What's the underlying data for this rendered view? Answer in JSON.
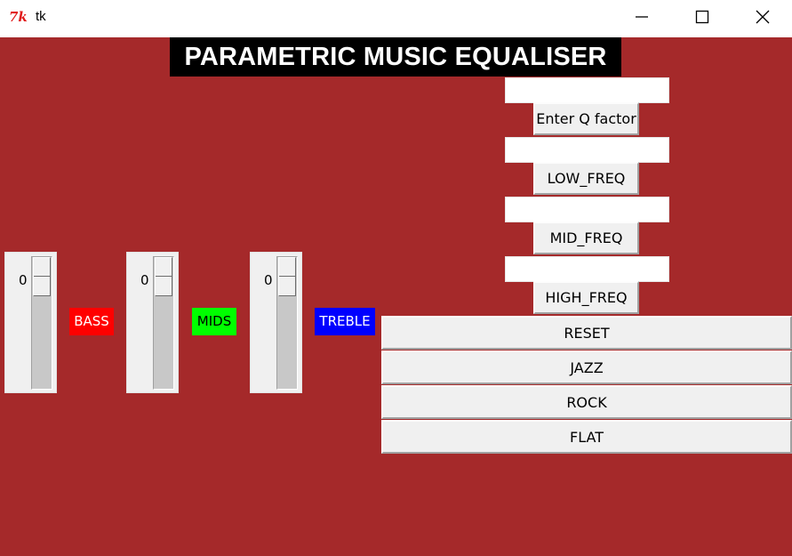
{
  "window": {
    "title": "tk",
    "icon_name": "tk-feather-icon",
    "controls": {
      "minimize_icon": "minimize-icon",
      "maximize_icon": "maximize-icon",
      "close_icon": "close-icon"
    }
  },
  "app": {
    "heading": "PARAMETRIC MUSIC EQUALISER",
    "background_color": "#a5292a"
  },
  "sliders": [
    {
      "name": "bass",
      "value": "0",
      "label": "BASS",
      "label_bg": "#ff0000",
      "label_fg": "#ffffff"
    },
    {
      "name": "mids",
      "value": "0",
      "label": "MIDS",
      "label_bg": "#00ff00",
      "label_fg": "#000000"
    },
    {
      "name": "treble",
      "value": "0",
      "label": "TREBLE",
      "label_bg": "#0000ff",
      "label_fg": "#ffffff"
    }
  ],
  "inputs": [
    {
      "value": "",
      "button_label": "Enter Q factor"
    },
    {
      "value": "",
      "button_label": "LOW_FREQ"
    },
    {
      "value": "",
      "button_label": "MID_FREQ"
    },
    {
      "value": "",
      "button_label": "HIGH_FREQ"
    }
  ],
  "presets": [
    "RESET",
    "JAZZ",
    "ROCK",
    "FLAT"
  ]
}
